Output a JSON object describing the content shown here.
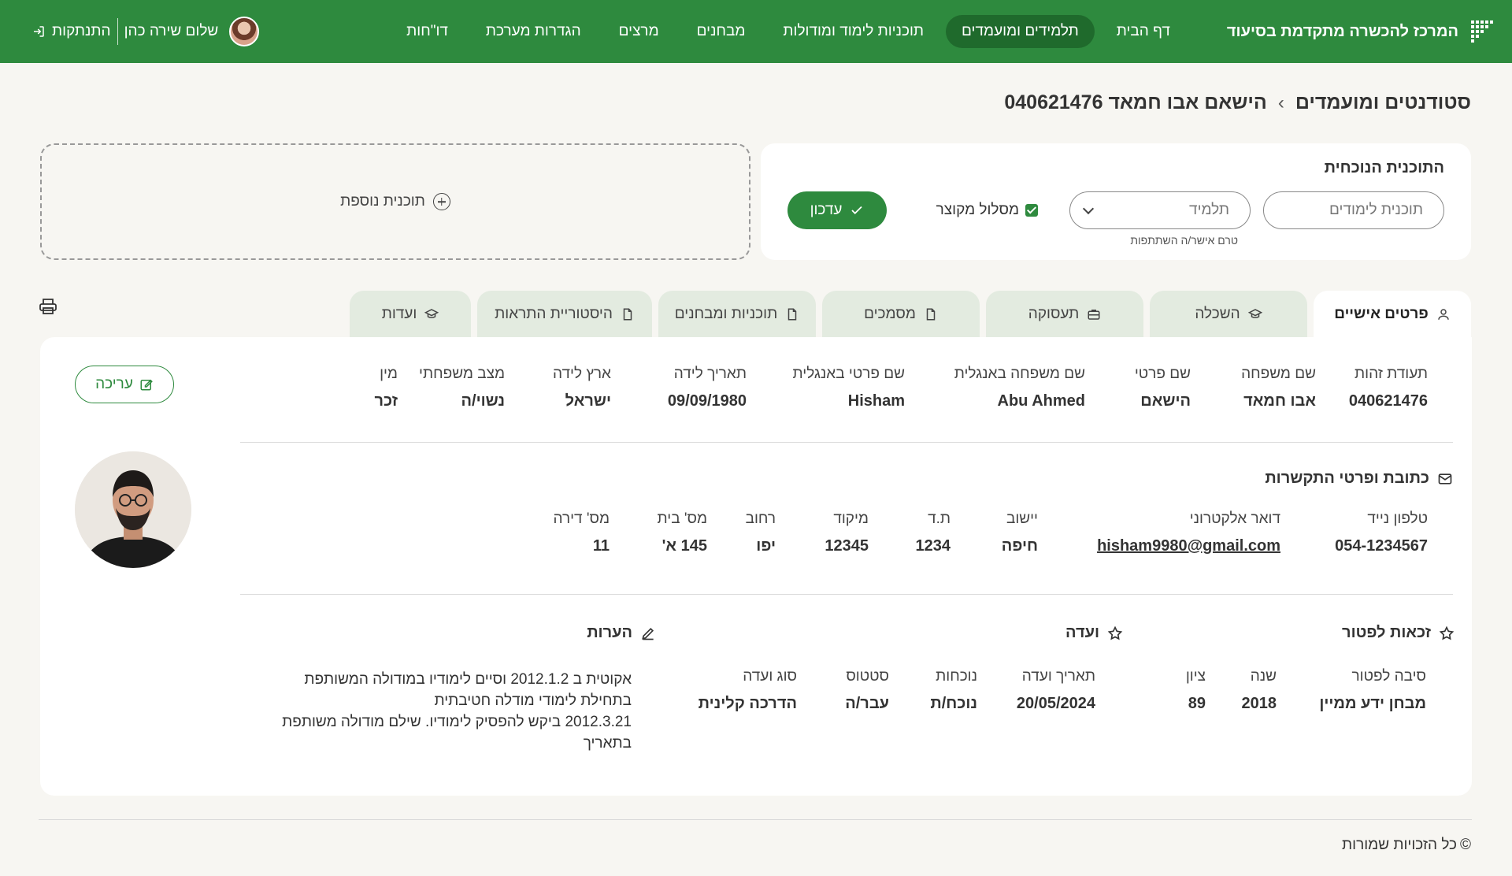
{
  "header": {
    "brand": "המרכז להכשרה מתקדמת בסיעוד",
    "nav": [
      "דף הבית",
      "תלמידים ומועמדים",
      "תוכניות לימוד ומודולות",
      "מבחנים",
      "מרצים",
      "הגדרות מערכת",
      "דו\"חות"
    ],
    "active_nav": "תלמידים ומועמדים",
    "user_name": "שלום שירה כהן",
    "logout": "התנתקות"
  },
  "breadcrumb": {
    "root": "סטודנטים ומועמדים",
    "separator": "›",
    "current": "הישאם אבו חמאד 040621476"
  },
  "program": {
    "title": "התוכנית הנוכחית",
    "program_placeholder": "תוכנית לימודים",
    "role_value": "תלמיד",
    "role_hint": "טרם אישר/ה השתתפות",
    "short_track_label": "מסלול מקוצר",
    "short_track_checked": true,
    "update_button": "עדכון",
    "add_program": "תוכנית נוספת"
  },
  "tabs": [
    {
      "label": "פרטים אישיים",
      "icon": "user-icon"
    },
    {
      "label": "השכלה",
      "icon": "graduation-cap-icon"
    },
    {
      "label": "תעסוקה",
      "icon": "briefcase-icon"
    },
    {
      "label": "מסמכים",
      "icon": "document-icon"
    },
    {
      "label": "תוכניות ומבחנים",
      "icon": "document-icon"
    },
    {
      "label": "היסטוריית התראות",
      "icon": "document-icon"
    },
    {
      "label": "ועדות",
      "icon": "graduation-cap-icon"
    }
  ],
  "personal": {
    "edit_button": "עריכה",
    "fields": [
      {
        "label": "תעודת זהות",
        "value": "040621476"
      },
      {
        "label": "שם משפחה",
        "value": "אבו חמאד"
      },
      {
        "label": "שם פרטי",
        "value": "הישאם"
      },
      {
        "label": "שם משפחה באנגלית",
        "value": "Abu Ahmed"
      },
      {
        "label": "שם פרטי באנגלית",
        "value": "Hisham"
      },
      {
        "label": "תאריך לידה",
        "value": "09/09/1980"
      },
      {
        "label": "ארץ לידה",
        "value": "ישראל"
      },
      {
        "label": "מצב משפחתי",
        "value": "נשוי/ה"
      },
      {
        "label": "מין",
        "value": "זכר"
      }
    ]
  },
  "contact": {
    "title": "כתובת ופרטי התקשרות",
    "fields": [
      {
        "label": "טלפון נייד",
        "value": "054-1234567"
      },
      {
        "label": "דואר אלקטרוני",
        "value": "hisham9980@gmail.com"
      },
      {
        "label": "יישוב",
        "value": "חיפה"
      },
      {
        "label": "ת.ד",
        "value": "1234"
      },
      {
        "label": "מיקוד",
        "value": "12345"
      },
      {
        "label": "רחוב",
        "value": "יפו"
      },
      {
        "label": "מס' בית",
        "value": "145 א'"
      },
      {
        "label": "מס' דירה",
        "value": "11"
      }
    ]
  },
  "exemption": {
    "title": "זכאות לפטור",
    "fields": [
      {
        "label": "סיבה לפטור",
        "value": "מבחן ידע ממיין"
      },
      {
        "label": "שנה",
        "value": "2018"
      },
      {
        "label": "ציון",
        "value": "89"
      }
    ]
  },
  "committee": {
    "title": "ועדה",
    "fields": [
      {
        "label": "תאריך ועדה",
        "value": "20/05/2024"
      },
      {
        "label": "נוכחות",
        "value": "נוכח/ת"
      },
      {
        "label": "סטטוס",
        "value": "עבר/ה"
      },
      {
        "label": "סוג ועדה",
        "value": "הדרכה קלינית"
      }
    ]
  },
  "notes": {
    "title": "הערות",
    "lines": [
      "אקוטית ב 2012.1.2 וסיים לימודיו במודולה המשותפת",
      "בתחילת לימודי מודלה חטיבתית",
      "2012.3.21 ביקש להפסיק לימודיו. שילם מודולה משותפת",
      "בתאריך"
    ]
  },
  "footer": {
    "copyright": "כל הזכויות שמורות",
    "copyright_symbol": "©"
  },
  "colors": {
    "primary": "#2e8a3e",
    "active_nav": "#1f6a2c",
    "tab_inactive": "#e3ebe0",
    "background": "#f7f6f2"
  }
}
